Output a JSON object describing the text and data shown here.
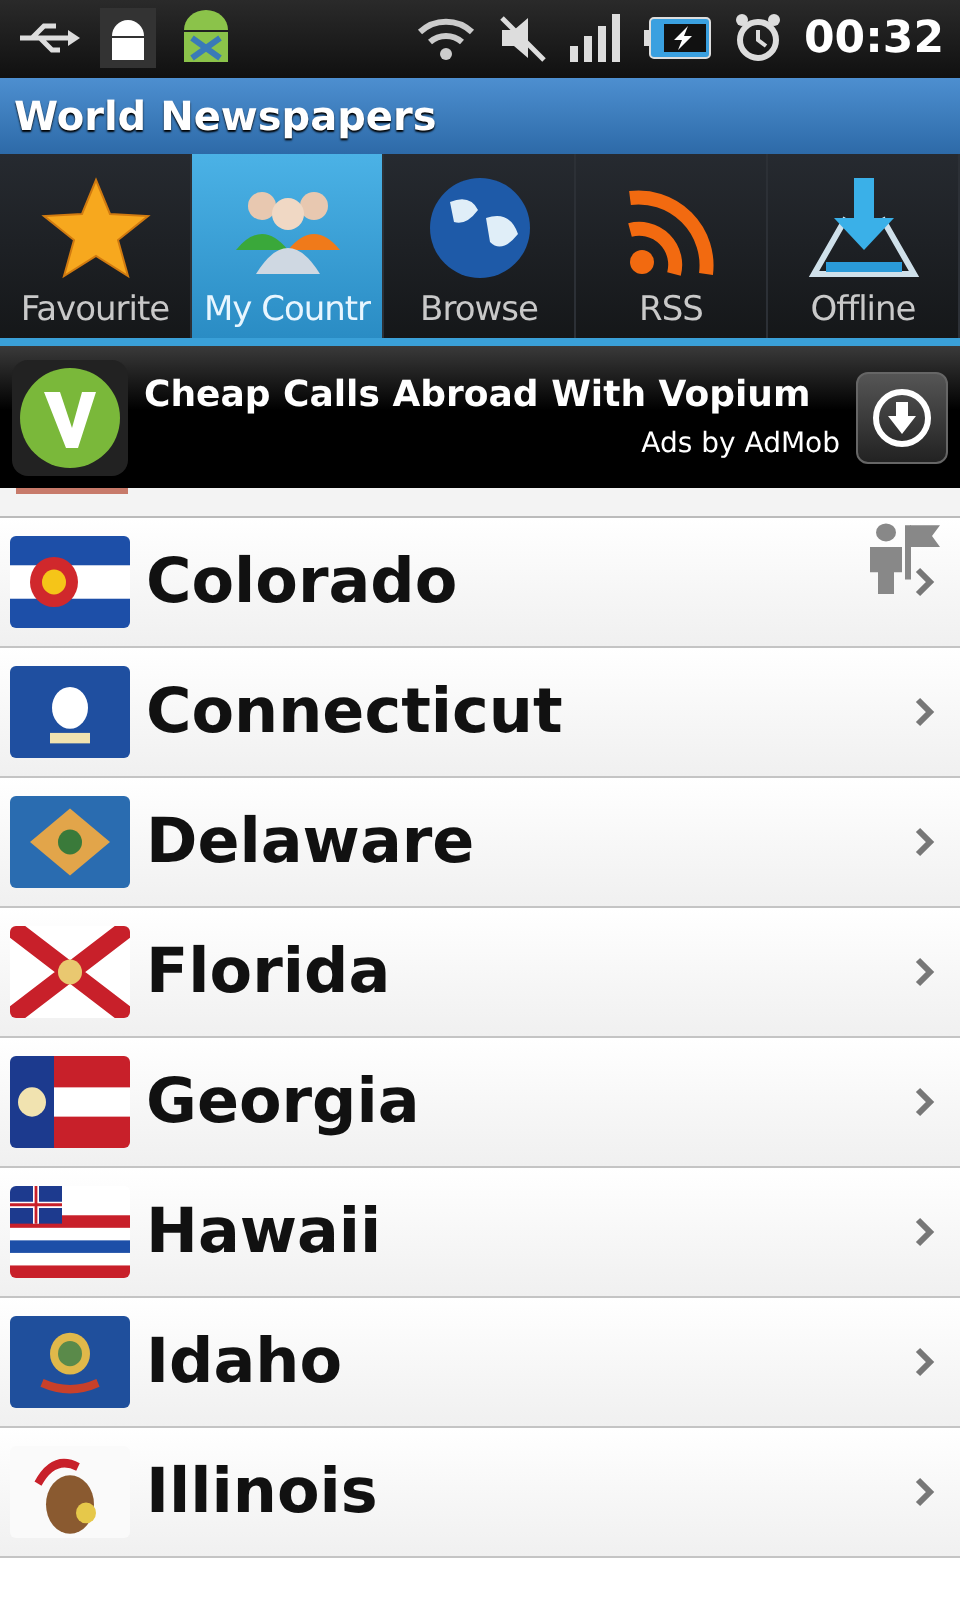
{
  "status_bar": {
    "time": "00:32"
  },
  "window": {
    "title": "World Newspapers"
  },
  "tabs": [
    {
      "label": "Favourite",
      "kind": "star",
      "selected": false
    },
    {
      "label": "My Countr",
      "kind": "people",
      "selected": true
    },
    {
      "label": "Browse",
      "kind": "globe",
      "selected": false
    },
    {
      "label": "RSS",
      "kind": "rss",
      "selected": false
    },
    {
      "label": "Offline",
      "kind": "download",
      "selected": false
    }
  ],
  "ad": {
    "headline": "Cheap Calls Abroad With Vopium",
    "attribution": "Ads by AdMob"
  },
  "states": [
    {
      "name": "Colorado"
    },
    {
      "name": "Connecticut"
    },
    {
      "name": "Delaware"
    },
    {
      "name": "Florida"
    },
    {
      "name": "Georgia"
    },
    {
      "name": "Hawaii"
    },
    {
      "name": "Idaho"
    },
    {
      "name": "Illinois"
    }
  ]
}
